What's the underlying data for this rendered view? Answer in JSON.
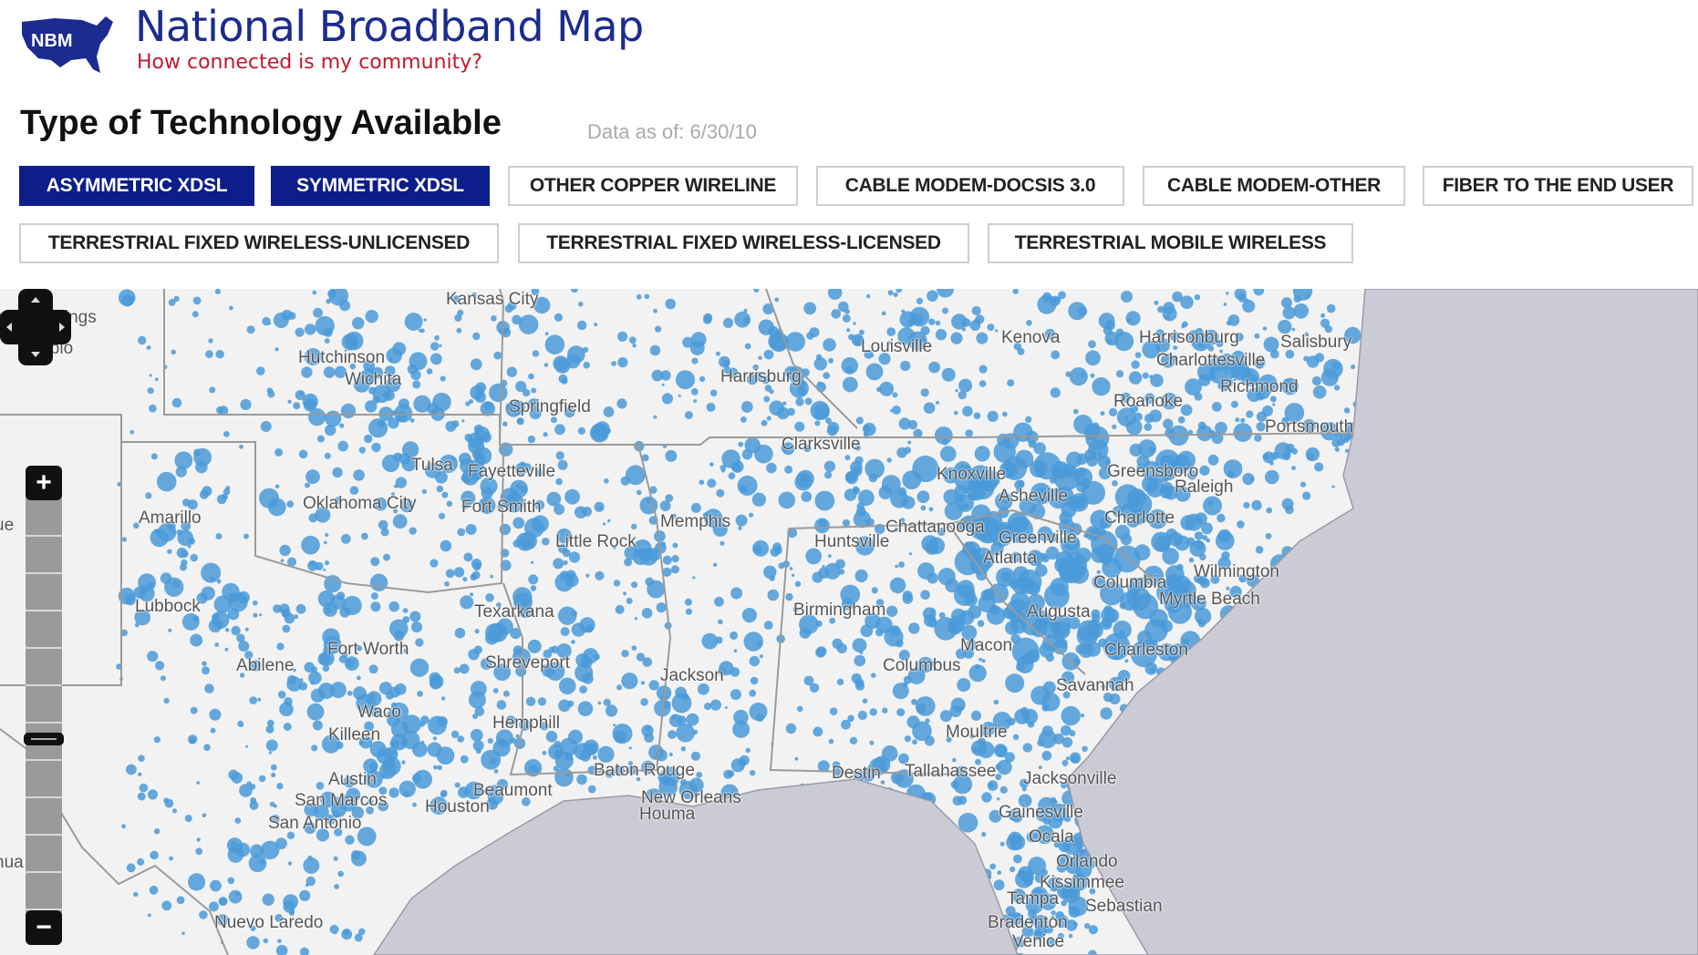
{
  "header": {
    "logo_text": "NBM",
    "title": "National Broadband Map",
    "tagline": "How connected is my community?"
  },
  "section": {
    "heading": "Type of Technology Available",
    "data_as_of": "Data as of: 6/30/10"
  },
  "technology_buttons": [
    {
      "label": "ASYMMETRIC XDSL",
      "selected": true
    },
    {
      "label": "SYMMETRIC XDSL",
      "selected": true
    },
    {
      "label": "OTHER COPPER WIRELINE",
      "selected": false
    },
    {
      "label": "CABLE MODEM-DOCSIS 3.0",
      "selected": false
    },
    {
      "label": "CABLE MODEM-OTHER",
      "selected": false
    },
    {
      "label": "FIBER TO THE END USER",
      "selected": false
    },
    {
      "label": "TERRESTRIAL FIXED WIRELESS-UNLICENSED",
      "selected": false
    },
    {
      "label": "TERRESTRIAL FIXED WIRELESS-LICENSED",
      "selected": false
    },
    {
      "label": "TERRESTRIAL MOBILE WIRELESS",
      "selected": false
    }
  ],
  "colors": {
    "brand": "#0d1e8a",
    "tagline": "#c0192e",
    "coverage": "#4a9ad8",
    "land": "#f2f2f2",
    "water": "#cbcbd6"
  },
  "map": {
    "cities": [
      "rado Springs",
      "Pueblo",
      "Kansas City",
      "Hutchinson",
      "Wichita",
      "Springfield",
      "Louisville",
      "Harrisburg",
      "Kenova",
      "Harrisonburg",
      "Charlottesville",
      "Salisbury",
      "Richmond",
      "Roanoke",
      "Portsmouth",
      "Tulsa",
      "Fayetteville",
      "Oklahoma City",
      "Fort Smith",
      "Amarillo",
      "Little Rock",
      "Memphis",
      "Clarksville",
      "Knoxville",
      "Asheville",
      "Greensboro",
      "Raleigh",
      "Charlotte",
      "Huntsville",
      "Chattanooga",
      "Greenville",
      "Atlanta",
      "Columbia",
      "Wilmington",
      "Myrtle Beach",
      "Augusta",
      "Charleston",
      "Savannah",
      "Birmingham",
      "Macon",
      "Columbus",
      "Texarkana",
      "Shreveport",
      "Jackson",
      "Lubbock",
      "Fort Worth",
      "Abilene",
      "Waco",
      "Killeen",
      "Hemphill",
      "Austin",
      "San Marcos",
      "San Antonio",
      "Houston",
      "Beaumont",
      "Baton Rouge",
      "New Orleans",
      "Houma",
      "Destin",
      "Tallahassee",
      "Moultrie",
      "Jacksonville",
      "Gainesville",
      "Ocala",
      "Orlando",
      "Kissimmee",
      "Sebastian",
      "Tampa",
      "Bradenton",
      "Venice",
      "Nuevo Laredo",
      "hua",
      "ue"
    ],
    "controls": {
      "pan_icon": "pan-arrows-icon",
      "zoom_in_label": "+",
      "zoom_out_label": "−",
      "zoom_level_fraction": 0.62
    }
  }
}
